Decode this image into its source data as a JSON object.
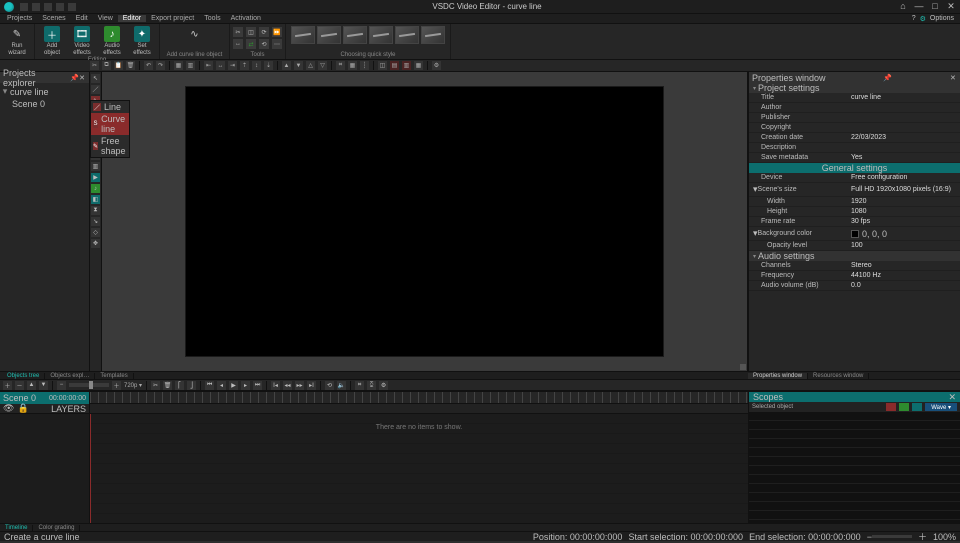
{
  "app": {
    "title": "VSDC Video Editor - curve line"
  },
  "window_controls": {
    "min": "—",
    "max": "□",
    "close": "✕",
    "home": "⌂"
  },
  "menu": {
    "items": [
      "Projects",
      "Scenes",
      "Edit",
      "View",
      "Editor",
      "Export project",
      "Tools",
      "Activation"
    ],
    "active": "Editor",
    "right": {
      "help": "?",
      "options": "Options"
    }
  },
  "ribbon": {
    "groups": {
      "wizard": {
        "label": "Run\nwizard",
        "caption": ""
      },
      "add": {
        "label": "Add\nobject",
        "caption": ""
      },
      "video": {
        "label": "Video\neffects",
        "caption": ""
      },
      "audio": {
        "label": "Audio\neffects",
        "caption": ""
      },
      "text": {
        "label": "Set\neffects",
        "caption": ""
      },
      "editing_caption": "Editing",
      "drawing_caption": "Add curve line object",
      "tools_caption": "Tools",
      "quickstyle_caption": "Choosing quick style"
    }
  },
  "left_panel": {
    "title": "Projects explorer",
    "nodes": [
      {
        "label": "curve line",
        "children": [
          {
            "label": "Scene 0"
          }
        ]
      }
    ]
  },
  "vertical_tools": [
    "select",
    "line",
    "curve",
    "rectangle",
    "ellipse",
    "free-shape",
    "text",
    "sprite",
    "chart",
    "pencil",
    "tooltip",
    "audio",
    "tracker",
    "arrow",
    "crop",
    "move"
  ],
  "shape_popup": {
    "items": [
      {
        "label": "Line"
      },
      {
        "label": "Curve line",
        "active": true
      },
      {
        "label": "Free shape"
      }
    ]
  },
  "tabs_row": {
    "items": [
      "Objects tree",
      "Objects expl…",
      "Templates"
    ],
    "active": "Objects tree"
  },
  "transport": {
    "resolution": "720p ▾"
  },
  "timeline": {
    "scene_label": "Scene 0",
    "timecode": "00:00:00:00",
    "empty_msg": "There are no items to show."
  },
  "right_panel": {
    "title": "Properties window",
    "section_project_settings": "Project settings",
    "general": {
      "Title": "curve line",
      "Author": "",
      "Publisher": "",
      "Copyright": "",
      "Creation date": "22/03/2023",
      "Description": "",
      "Save metadata": "Yes"
    },
    "general_settings_bar": "General settings",
    "device": {
      "Device": "Free configuration"
    },
    "scene_size": {
      "Scene's size": "Full HD 1920x1080 pixels (16:9)",
      "Width": "1920",
      "Height": "1080"
    },
    "fps": {
      "Frame rate": "30 fps"
    },
    "bg": {
      "Background color": " 0, 0, 0",
      "Opacity level": "100"
    },
    "audio_settings_hdr": "Audio settings",
    "audio": {
      "Channels": "Stereo",
      "Frequency": "44100 Hz",
      "Audio volume (dB)": "0.0"
    },
    "tabs": {
      "items": [
        "Properties window",
        "Resources window"
      ],
      "active": "Properties window"
    }
  },
  "scopes": {
    "title": "Scopes",
    "selected_label": "Selected object",
    "mode": "Wave ▾"
  },
  "bottom_tabs": {
    "items": [
      "Timeline",
      "Color grading"
    ],
    "active": "Timeline"
  },
  "status": {
    "hint": "Create a curve line",
    "position_label": "Position:",
    "position": "00:00:00:000",
    "start_sel_label": "Start selection:",
    "start_sel": "00:00:00:000",
    "end_sel_label": "End selection:",
    "end_sel": "00:00:00:000",
    "zoom_label": "100%"
  }
}
